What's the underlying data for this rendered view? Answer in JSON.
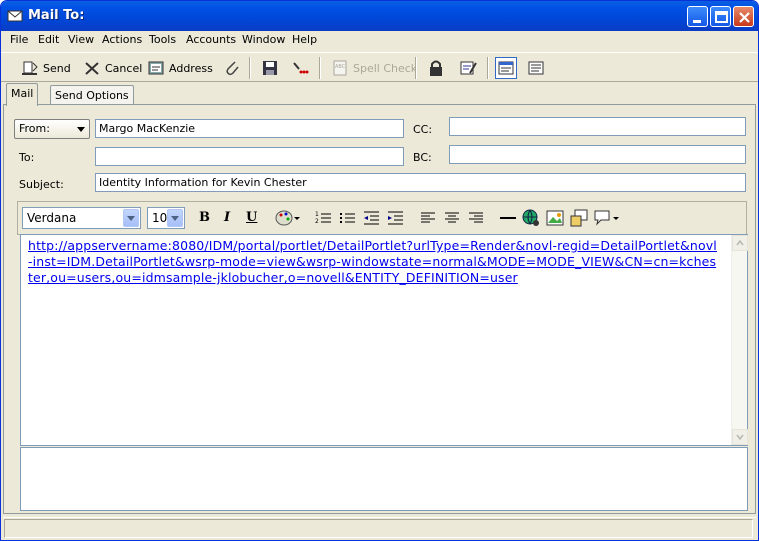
{
  "window": {
    "title": "Mail To:"
  },
  "menu": [
    "File",
    "Edit",
    "View",
    "Actions",
    "Tools",
    "Accounts",
    "Window",
    "Help"
  ],
  "toolbar": {
    "send": "Send",
    "cancel": "Cancel",
    "address": "Address",
    "spellcheck": "Spell Check"
  },
  "tabs": [
    "Mail",
    "Send Options"
  ],
  "form": {
    "from_label": "From:",
    "from_value": "Margo MacKenzie",
    "to_label": "To:",
    "to_value": "",
    "cc_label": "CC:",
    "cc_value": "",
    "bc_label": "BC:",
    "bc_value": "",
    "subject_label": "Subject:",
    "subject_value": "Identity Information for Kevin Chester"
  },
  "format": {
    "font": "Verdana",
    "size": "10",
    "bold": "B",
    "italic": "I",
    "underline": "U"
  },
  "body": {
    "link": "http://appservername:8080/IDM/portal/portlet/DetailPortlet?urlType=Render&novl-regid=DetailPortlet&novl-inst=IDM.DetailPortlet&wsrp-mode=view&wsrp-windowstate=normal&MODE=MODE_VIEW&CN=cn=kchester,ou=users,ou=idmsample-jklobucher,o=novell&ENTITY_DEFINITION=user"
  },
  "colors": {
    "titlebar": "#0052e6",
    "link": "#0000ee",
    "chrome": "#ece9d8"
  }
}
